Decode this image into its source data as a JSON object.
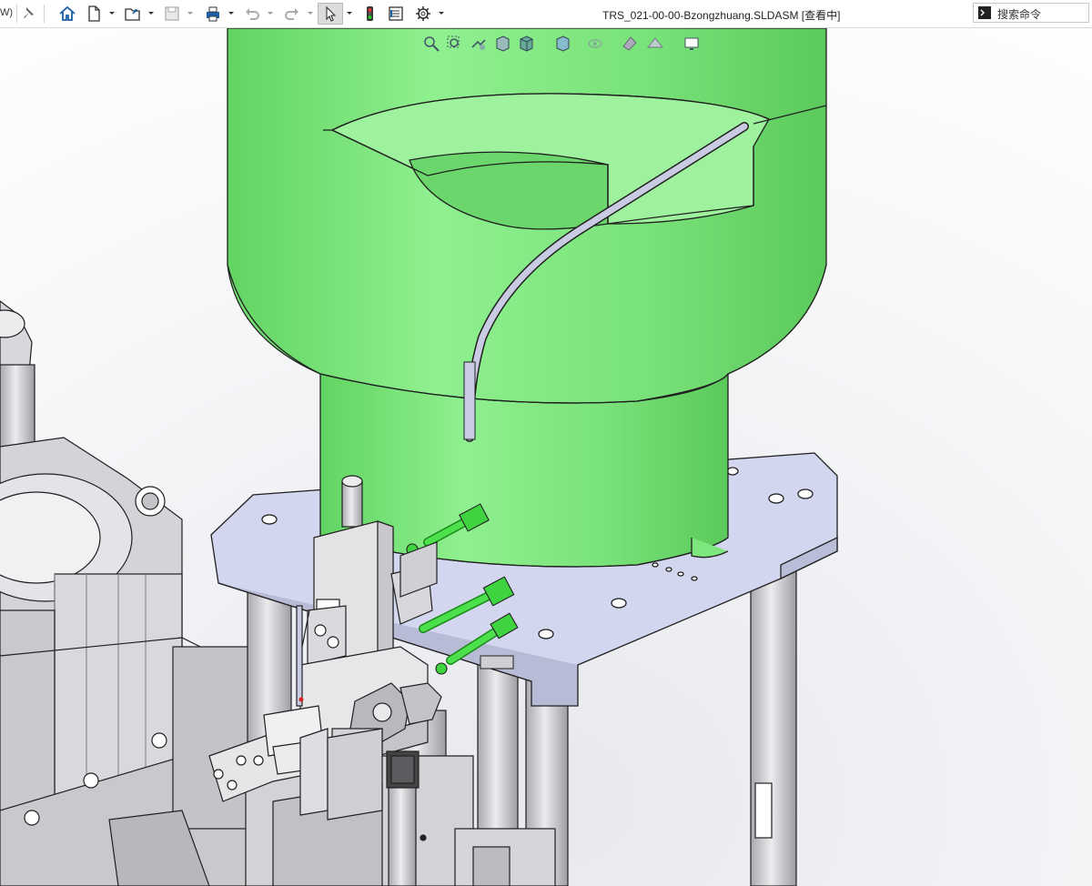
{
  "window": {
    "left_fragment": "W)",
    "title": "TRS_021-00-00-Bzongzhuang.SLDASM [查看中]"
  },
  "toolbar": {
    "buttons": [
      {
        "name": "pin-icon"
      },
      {
        "name": "home-icon"
      },
      {
        "name": "new-document-icon"
      },
      {
        "name": "open-folder-icon"
      },
      {
        "name": "save-icon"
      },
      {
        "name": "print-icon"
      },
      {
        "name": "undo-icon"
      },
      {
        "name": "redo-icon"
      },
      {
        "name": "select-pointer-icon"
      },
      {
        "name": "rebuild-traffic-light-icon"
      },
      {
        "name": "file-properties-icon"
      },
      {
        "name": "options-gear-icon"
      }
    ]
  },
  "search": {
    "placeholder": "搜索命令",
    "icon": "command-prompt-icon"
  },
  "heads_up_toolbar": {
    "icons": [
      "zoom-to-fit-icon",
      "zoom-to-area-icon",
      "previous-view-icon",
      "section-view-icon",
      "view-orientation-icon",
      "display-style-icon",
      "hide-show-items-icon",
      "edit-appearance-icon",
      "apply-scene-icon",
      "view-settings-icon"
    ]
  },
  "colors": {
    "bowl_green": "#7de67d",
    "bowl_green_dark": "#5fcf5f",
    "plate": "#d2d6ee",
    "metal": "#d9d9dc",
    "metal_dark": "#a9a9ae",
    "tube": "#c9cbe3",
    "outline": "#202020"
  }
}
